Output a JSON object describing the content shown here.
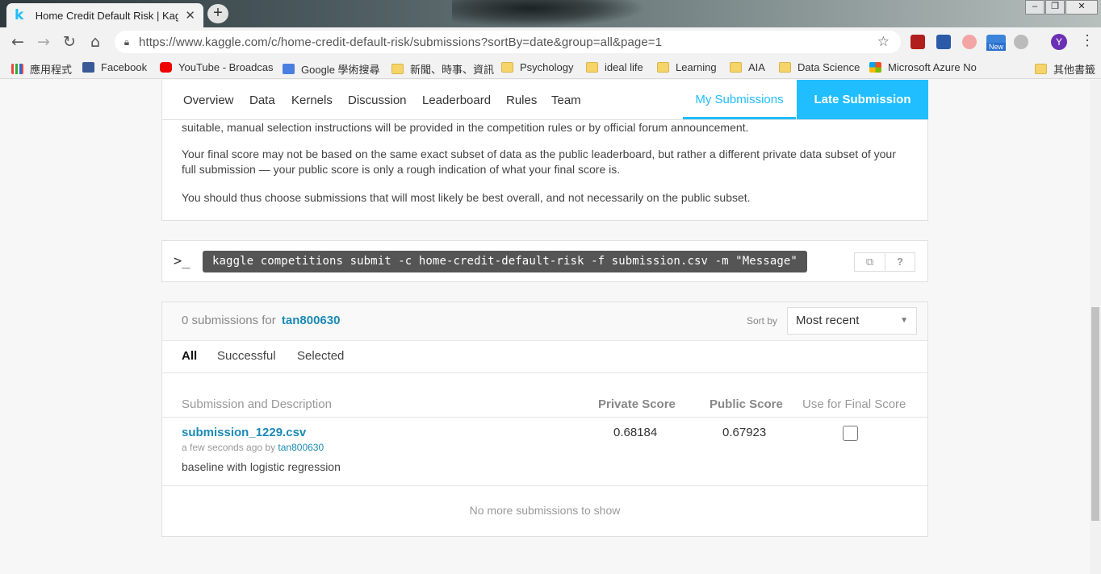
{
  "browser": {
    "tab_title": "Home Credit Default Risk | Kaggle",
    "tab_icon": "k",
    "url": "https://www.kaggle.com/c/home-credit-default-risk/submissions?sortBy=date&group=all&page=1",
    "profile_initial": "Y",
    "new_badge": "New",
    "bookmarks": [
      {
        "label": "應用程式",
        "icon": "apps-grid-icon"
      },
      {
        "label": "Facebook",
        "icon": "facebook-icon"
      },
      {
        "label": "YouTube - Broadcas",
        "icon": "youtube-icon"
      },
      {
        "label": "Google 學術搜尋",
        "icon": "google-scholar-icon"
      },
      {
        "label": "新聞、時事、資訊",
        "icon": "folder-icon"
      },
      {
        "label": "Psychology",
        "icon": "folder-icon"
      },
      {
        "label": "ideal life",
        "icon": "folder-icon"
      },
      {
        "label": "Learning",
        "icon": "folder-icon"
      },
      {
        "label": "AIA",
        "icon": "folder-icon"
      },
      {
        "label": "Data Science",
        "icon": "folder-icon"
      },
      {
        "label": "Microsoft Azure No",
        "icon": "microsoft-icon"
      },
      {
        "label": "其他書籤",
        "icon": "folder-icon"
      }
    ]
  },
  "subnav": {
    "items": [
      "Overview",
      "Data",
      "Kernels",
      "Discussion",
      "Leaderboard",
      "Rules",
      "Team"
    ],
    "my_submissions": "My Submissions",
    "late_submission": "Late Submission"
  },
  "info": {
    "p1": "suitable, manual selection instructions will be provided in the competition rules or by official forum announcement.",
    "p2": "Your final score may not be based on the same exact subset of data as the public leaderboard, but rather a different private data subset of your full submission — your public score is only a rough indication of what your final score is.",
    "p3": "You should thus choose submissions that will most likely be best overall, and not necessarily on the public subset."
  },
  "cli": {
    "prompt": ">_",
    "command": "kaggle competitions submit -c home-credit-default-risk -f submission.csv -m \"Message\"",
    "help": "?"
  },
  "submissions": {
    "count_text": "0 submissions for",
    "user": "tan800630",
    "sort_label": "Sort by",
    "sort_value": "Most recent",
    "tabs": [
      "All",
      "Successful",
      "Selected"
    ],
    "columns": {
      "description": "Submission and Description",
      "private": "Private Score",
      "public": "Public Score",
      "final": "Use for Final Score"
    },
    "rows": [
      {
        "filename": "submission_1229.csv",
        "time": "a few seconds ago by",
        "by": "tan800630",
        "description": "baseline with logistic regression",
        "private_score": "0.68184",
        "public_score": "0.67923",
        "use_for_final": false
      }
    ],
    "no_more": "No more submissions to show"
  },
  "colors": {
    "accent": "#20beff",
    "link": "#1a8ab5"
  }
}
